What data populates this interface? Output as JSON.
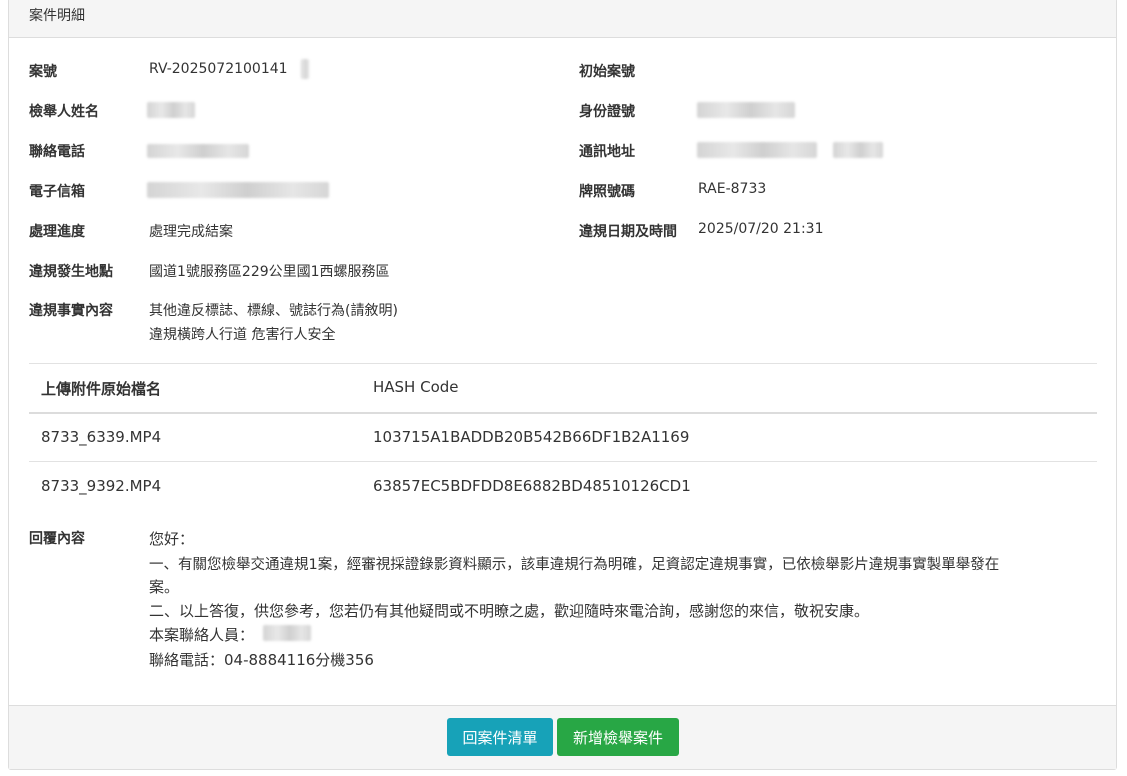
{
  "panel": {
    "title": "案件明細"
  },
  "fields": {
    "case_no_label": "案號",
    "case_no_value": "RV-2025072100141",
    "initial_case_no_label": "初始案號",
    "reporter_name_label": "檢舉人姓名",
    "id_no_label": "身份證號",
    "phone_label": "聯絡電話",
    "address_label": "通訊地址",
    "email_label": "電子信箱",
    "plate_label": "牌照號碼",
    "plate_value": "RAE-8733",
    "progress_label": "處理進度",
    "progress_value": "處理完成結案",
    "violation_datetime_label": "違規日期及時間",
    "violation_datetime_value": "2025/07/20 21:31",
    "location_label": "違規發生地點",
    "location_value": "國道1號服務區229公里國1西螺服務區",
    "facts_label": "違規事實內容",
    "facts_line1": "其他違反標誌、標線、號誌行為(請敘明)",
    "facts_line2": "違規橫跨人行道 危害行人安全"
  },
  "attachments": {
    "col_filename": "上傳附件原始檔名",
    "col_hash": "HASH Code",
    "rows": [
      {
        "filename": "8733_6339.MP4",
        "hash": "103715A1BADDB20B542B66DF1B2A1169"
      },
      {
        "filename": "8733_9392.MP4",
        "hash": "63857EC5BDFDD8E6882BD48510126CD1"
      }
    ]
  },
  "reply": {
    "label": "回覆內容",
    "line1": "您好：",
    "line2": "一、有關您檢舉交通違規1案，經審視採證錄影資料顯示，該車違規行為明確，足資認定違規事實，已依檢舉影片違規事實製單舉發在",
    "line3": "案。",
    "line4": "二、以上答復，供您參考，您若仍有其他疑問或不明瞭之處，歡迎隨時來電洽詢，感謝您的來信，敬祝安康。",
    "line5": "本案聯絡人員：",
    "line6": "聯絡電話：04-8884116分機356"
  },
  "footer": {
    "back_button": "回案件清單",
    "new_button": "新增檢舉案件"
  }
}
